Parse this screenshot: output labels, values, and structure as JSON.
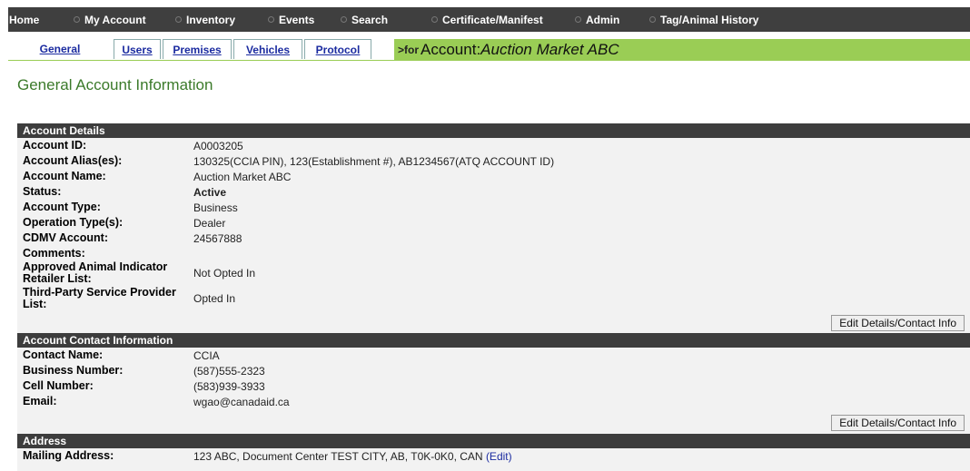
{
  "nav": {
    "items": [
      {
        "label": "Home"
      },
      {
        "label": "My Account"
      },
      {
        "label": "Inventory"
      },
      {
        "label": "Events"
      },
      {
        "label": "Search"
      },
      {
        "label": "Certificate/Manifest"
      },
      {
        "label": "Admin"
      },
      {
        "label": "Tag/Animal History"
      }
    ]
  },
  "tabs": [
    {
      "label": "General"
    },
    {
      "label": "Users"
    },
    {
      "label": "Premises"
    },
    {
      "label": "Vehicles"
    },
    {
      "label": "Protocol"
    }
  ],
  "account_bar": {
    "prefix": ">for",
    "label": "Account:",
    "name": "Auction Market ABC"
  },
  "page_title": "General Account Information",
  "account_details": {
    "header": "Account Details",
    "rows": [
      {
        "label": "Account ID:",
        "value": "A0003205"
      },
      {
        "label": "Account Alias(es):",
        "value": "130325(CCIA PIN), 123(Establishment #), AB1234567(ATQ ACCOUNT ID)"
      },
      {
        "label": "Account Name:",
        "value": "Auction Market ABC"
      },
      {
        "label": "Status:",
        "value": "Active"
      },
      {
        "label": "Account Type:",
        "value": "Business"
      },
      {
        "label": "Operation Type(s):",
        "value": "Dealer"
      },
      {
        "label": "CDMV Account:",
        "value": "24567888"
      },
      {
        "label": "Comments:",
        "value": ""
      },
      {
        "label": "Approved Animal Indicator Retailer List:",
        "value": "Not Opted In"
      },
      {
        "label": "Third-Party Service Provider List:",
        "value": "Opted In"
      }
    ],
    "button": "Edit Details/Contact Info"
  },
  "contact_info": {
    "header": "Account Contact Information",
    "rows": [
      {
        "label": "Contact Name:",
        "value": "CCIA"
      },
      {
        "label": "Business Number:",
        "value": "(587)555-2323"
      },
      {
        "label": "Cell Number:",
        "value": "(583)939-3933"
      },
      {
        "label": "Email:",
        "value": "wgao@canadaid.ca"
      }
    ],
    "button": "Edit Details/Contact Info"
  },
  "address": {
    "header": "Address",
    "rows": [
      {
        "label": "Mailing Address:",
        "value": "123 ABC, Document Center TEST CITY, AB, T0K-0K0, CAN",
        "link": "(Edit)"
      }
    ]
  },
  "colors": {
    "nav_bg": "#3f3f3f",
    "account_bar_bg": "#9acd55",
    "section_header_bg": "#3d3d3d",
    "panel_bg": "#f2f2f2",
    "title_green": "#3b7a2a",
    "link_blue": "#1b2ba0"
  }
}
